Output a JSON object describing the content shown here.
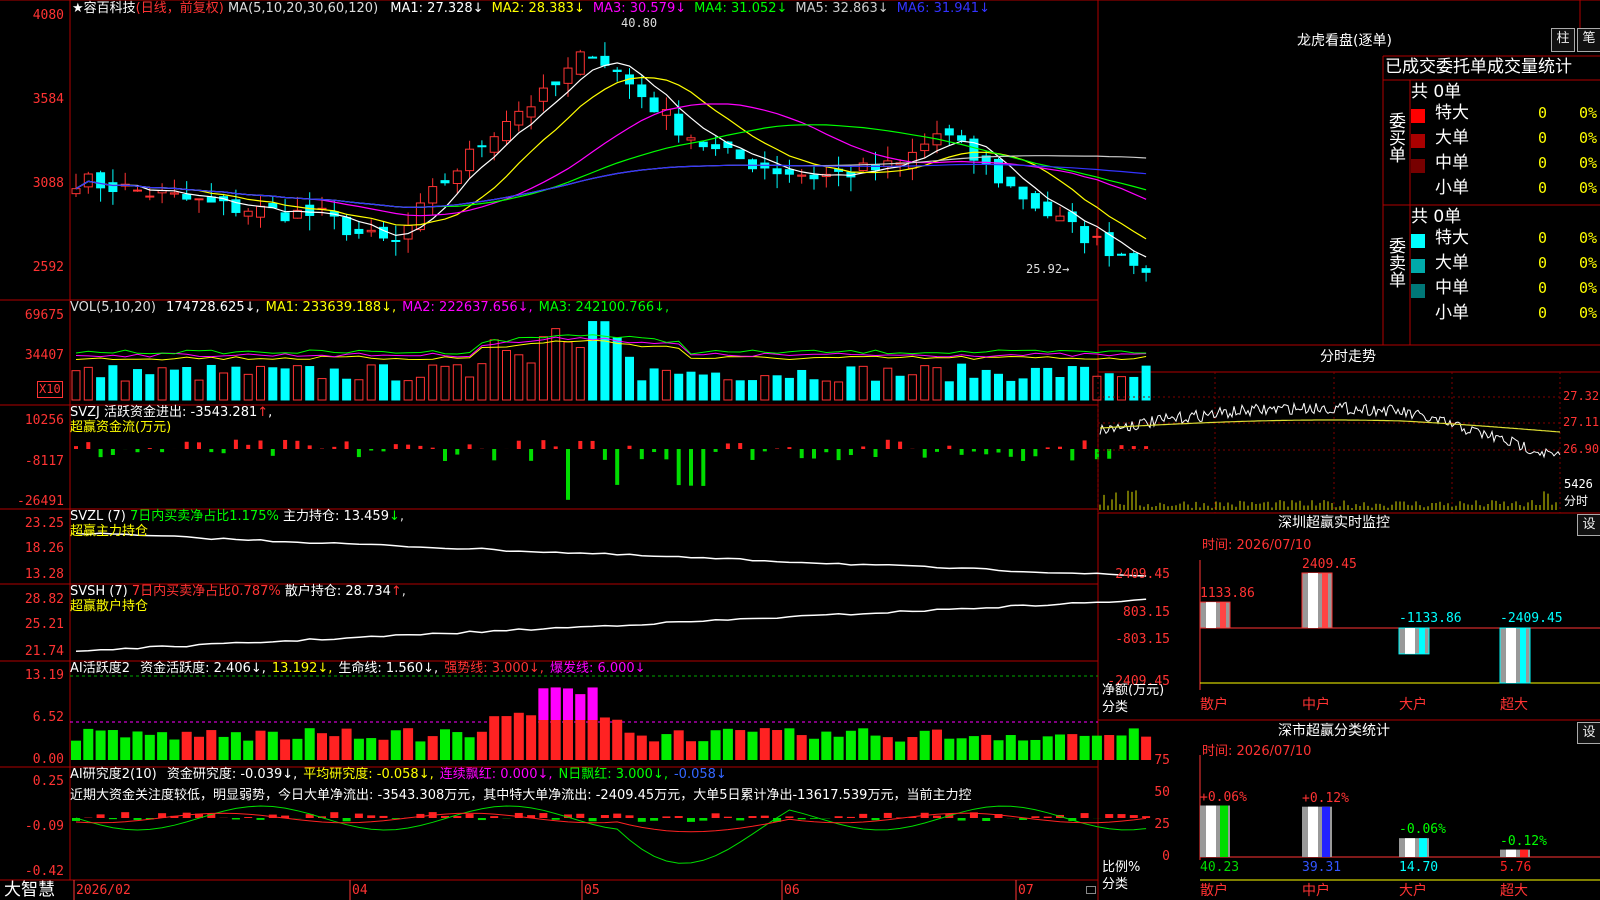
{
  "left": {
    "stock_name": "容百科技",
    "period_label": "(日线，前复权)",
    "ma_header": "MA(5,10,20,30,60,120)",
    "ma_values": [
      {
        "label": "MA1:",
        "value": "27.328",
        "color": "#ffffff"
      },
      {
        "label": "MA2:",
        "value": "28.383",
        "color": "#ffff00"
      },
      {
        "label": "MA3:",
        "value": "30.579",
        "color": "#ff00ff"
      },
      {
        "label": "MA4:",
        "value": "31.052",
        "color": "#00ff00"
      },
      {
        "label": "MA5:",
        "value": "32.863",
        "color": "#cccccc"
      },
      {
        "label": "MA6:",
        "value": "31.941",
        "color": "#3333ff"
      }
    ],
    "price_axis": [
      "4080",
      "3584",
      "3088",
      "2592"
    ],
    "high_label": "40.80",
    "low_label": "25.92",
    "vol_header": "VOL(5,10,20)",
    "vol_values": [
      {
        "label": "",
        "value": "174728.625",
        "color": "#ffffff"
      },
      {
        "label": "MA1:",
        "value": "233639.188",
        "color": "#ffff00"
      },
      {
        "label": "MA2:",
        "value": "222637.656",
        "color": "#ff00ff"
      },
      {
        "label": "MA3:",
        "value": "242100.766",
        "color": "#00ff00"
      }
    ],
    "vol_axis": [
      "69675",
      "34407"
    ],
    "vol_unit": "X10",
    "svzj_header": "SVZJ  活跃资金进出: -3543.281",
    "svzj_sub": "超赢资金流(万元)",
    "svzj_axis": [
      "10256",
      "-8117",
      "-26491"
    ],
    "svzl_header": "SVZL (7)",
    "svzl_ratio": "7日内买卖净占比1.175%",
    "svzl_hold": "主力持仓: 13.459",
    "svzl_sub": "超赢主力持仓",
    "svzl_axis": [
      "23.25",
      "18.26",
      "13.28"
    ],
    "svsh_header": "SVSH (7)",
    "svsh_ratio": "7日内买卖净占比0.787%",
    "svsh_hold": "散户持仓: 28.734",
    "svsh_sub": "超赢散户持仓",
    "svsh_axis": [
      "28.82",
      "25.21",
      "21.74"
    ],
    "ai_header": "AI活跃度2",
    "ai_values": [
      {
        "text": "资金活跃度: 2.406",
        "color": "#ffffff"
      },
      {
        "text": "13.192",
        "color": "#ffff00"
      },
      {
        "text": "生命线: 1.560",
        "color": "#ffffff"
      },
      {
        "text": "强势线: 3.000",
        "color": "#ff3333"
      },
      {
        "text": "爆发线: 6.000",
        "color": "#ff00ff"
      }
    ],
    "ai_axis": [
      "13.19",
      "6.52",
      "0.00"
    ],
    "research_header": "AI研究度2(10)",
    "research_values": [
      {
        "text": "资金研究度: -0.039",
        "color": "#ffffff"
      },
      {
        "text": "平均研究度: -0.058",
        "color": "#ffff00"
      },
      {
        "text": "连续飘红: 0.000",
        "color": "#ff00ff"
      },
      {
        "text": "N日飘红: 3.000",
        "color": "#00ff00"
      },
      {
        "text": "-0.058",
        "color": "#3366ff"
      }
    ],
    "research_text": "近期大资金关注度较低，明显弱势，今日大单净流出: -3543.308万元，其中特大单净流出: -2409.45万元，大单5日累计净出-13617.539万元，当前主力控",
    "research_axis": [
      "0.25",
      "-0.09",
      "-0.42"
    ],
    "date_labels": [
      "2026/02",
      "04",
      "05",
      "06",
      "07"
    ],
    "brand": "大智慧"
  },
  "right": {
    "lhb_title": "龙虎看盘(逐单)",
    "btn_zhu": "柱",
    "btn_bi": "笔",
    "stats_title": "已成交委托单成交量统计",
    "buy_label": "委买单",
    "sell_label": "委卖单",
    "buy_total": "共 0单",
    "sell_total": "共 0单",
    "buy_rows": [
      {
        "name": "特大",
        "count": "0",
        "pct": "0%",
        "color": "#ff0000"
      },
      {
        "name": "大单",
        "count": "0",
        "pct": "0%",
        "color": "#aa0000"
      },
      {
        "name": "中单",
        "count": "0",
        "pct": "0%",
        "color": "#770000"
      },
      {
        "name": "小单",
        "count": "0",
        "pct": "0%",
        "color": "#000000"
      }
    ],
    "sell_rows": [
      {
        "name": "特大",
        "count": "0",
        "pct": "0%",
        "color": "#00ffff"
      },
      {
        "name": "大单",
        "count": "0",
        "pct": "0%",
        "color": "#00aaaa"
      },
      {
        "name": "中单",
        "count": "0",
        "pct": "0%",
        "color": "#007777"
      },
      {
        "name": "小单",
        "count": "0",
        "pct": "0%",
        "color": "#000000"
      }
    ],
    "intraday_title": "分时走势",
    "intraday_axis": [
      "27.32",
      "27.11",
      "26.90"
    ],
    "intraday_vol": "5426",
    "intraday_unit": "分时",
    "monitor_title": "深圳超赢实时监控",
    "monitor_btn": "设",
    "monitor_time": "时间: 2026/07/10",
    "monitor_axis": [
      "2409.45",
      "803.15",
      "-803.15",
      "-2409.45"
    ],
    "monitor_ylabel": "净额(万元)",
    "monitor_xlabel": "分类",
    "monitor_categories": [
      "散户",
      "中户",
      "大户",
      "超大"
    ],
    "monitor_values": [
      1133.86,
      2409.45,
      -1133.86,
      -2409.45
    ],
    "monitor_value_labels": [
      "1133.86",
      "2409.45",
      "-1133.86",
      "-2409.45"
    ],
    "class_title": "深市超赢分类统计",
    "class_btn": "设",
    "class_time": "时间: 2026/07/10",
    "class_axis": [
      "75",
      "50",
      "25",
      "0"
    ],
    "class_ylabel": "比例%",
    "class_xlabel": "分类",
    "class_categories": [
      "散户",
      "中户",
      "大户",
      "超大"
    ],
    "class_values": [
      40.23,
      39.31,
      14.7,
      5.76
    ],
    "class_value_labels": [
      "40.23",
      "39.31",
      "14.70",
      "5.76"
    ],
    "class_change_labels": [
      "+0.06%",
      "+0.12%",
      "-0.06%",
      "-0.12%"
    ],
    "class_bar_colors": [
      "#00dd00",
      "#2222ff",
      "#00ffff",
      "#ff2222"
    ]
  }
}
